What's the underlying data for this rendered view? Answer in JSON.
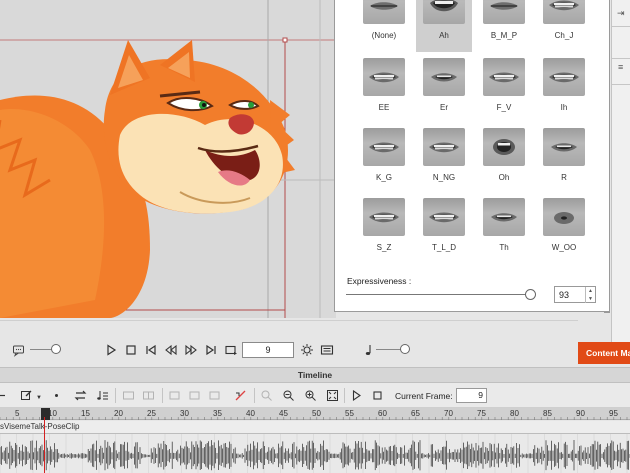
{
  "viseme_panel": {
    "visemes": [
      {
        "label": "(None)",
        "selected": false,
        "mouth": "closed"
      },
      {
        "label": "Ah",
        "selected": true,
        "mouth": "open"
      },
      {
        "label": "B_M_P",
        "selected": false,
        "mouth": "closed"
      },
      {
        "label": "Ch_J",
        "selected": false,
        "mouth": "teeth"
      },
      {
        "label": "EE",
        "selected": false,
        "mouth": "teeth"
      },
      {
        "label": "Er",
        "selected": false,
        "mouth": "small"
      },
      {
        "label": "F_V",
        "selected": false,
        "mouth": "teeth"
      },
      {
        "label": "Ih",
        "selected": false,
        "mouth": "teeth"
      },
      {
        "label": "K_G",
        "selected": false,
        "mouth": "teeth"
      },
      {
        "label": "N_NG",
        "selected": false,
        "mouth": "teeth"
      },
      {
        "label": "Oh",
        "selected": false,
        "mouth": "round"
      },
      {
        "label": "R",
        "selected": false,
        "mouth": "small"
      },
      {
        "label": "S_Z",
        "selected": false,
        "mouth": "teeth"
      },
      {
        "label": "T_L_D",
        "selected": false,
        "mouth": "teeth"
      },
      {
        "label": "Th",
        "selected": false,
        "mouth": "small"
      },
      {
        "label": "W_OO",
        "selected": false,
        "mouth": "pucker"
      }
    ],
    "expressiveness_label": "Expressiveness :",
    "expressiveness_value": "93",
    "expressiveness_level": 0.93
  },
  "content_manager_tab": "Content Manager",
  "playback": {
    "current_frame": "9"
  },
  "timeline": {
    "title": "Timeline",
    "current_frame_label": "Current Frame:",
    "current_frame_value": "9",
    "ruler_labels": [
      "5",
      "10",
      "15",
      "20",
      "25",
      "30",
      "35",
      "40",
      "45",
      "50",
      "55",
      "60",
      "65",
      "70",
      "75",
      "80",
      "85",
      "90",
      "95"
    ],
    "clip_label": "sVisemeTalk-PoseClip"
  },
  "colors": {
    "accent": "#e14a16",
    "cat_fur": "#f07a2a",
    "cat_muzzle": "#fbe2b5",
    "selected_cell": "#cfcfcf",
    "playhead": "#d42020"
  },
  "icons": [
    "chat-icon",
    "play-icon",
    "stop-icon",
    "skip-start-icon",
    "rewind-icon",
    "fast-forward-icon",
    "skip-end-icon",
    "loop-icon",
    "settings-sun-icon",
    "subtitle-icon",
    "music-note-icon",
    "undo-icon",
    "edit-icon",
    "music-list-icon",
    "swap-icon",
    "zoom-in-icon",
    "zoom-out-icon",
    "fit-icon"
  ]
}
